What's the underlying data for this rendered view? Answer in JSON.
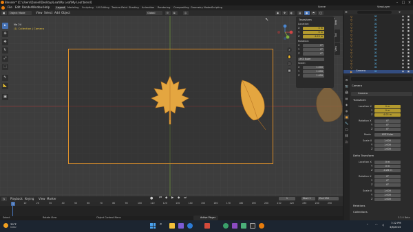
{
  "app": {
    "title": "Blender* [C:\\Users\\Daniel\\Desktop\\Leaf\\My Leaf\\My Leaf.blend]"
  },
  "menus": [
    "File",
    "Edit",
    "Render",
    "Window",
    "Help"
  ],
  "workspace_tabs": [
    {
      "label": "Layout",
      "active": true
    },
    {
      "label": "Modeling",
      "active": false
    },
    {
      "label": "Sculpting",
      "active": false
    },
    {
      "label": "UV Editing",
      "active": false
    },
    {
      "label": "Texture Paint",
      "active": false
    },
    {
      "label": "Shading",
      "active": false
    },
    {
      "label": "Animation",
      "active": false
    },
    {
      "label": "Rendering",
      "active": false
    },
    {
      "label": "Compositing",
      "active": false
    },
    {
      "label": "Geometry Nodes",
      "active": false
    },
    {
      "label": "Scripting",
      "active": false
    }
  ],
  "scene_label": "Scene",
  "viewlayer_label": "ViewLayer",
  "viewport_header": {
    "mode": "Object Mode",
    "menus": [
      "View",
      "Select",
      "Add",
      "Object"
    ],
    "transform_orientation": "Global",
    "options_label": "Options"
  },
  "viewport": {
    "camera_name": "No 24",
    "collection_path": "(1) Collection | Camera"
  },
  "npanel": {
    "title": "Transform",
    "location_label": "Location:",
    "location": [
      {
        "axis": "X",
        "value": "0 m"
      },
      {
        "axis": "Y",
        "value": "0 m"
      },
      {
        "axis": "Z",
        "value": "4.03 m"
      }
    ],
    "rotation_label": "Rotation:",
    "rotation": [
      {
        "axis": "X",
        "value": "0°"
      },
      {
        "axis": "Y",
        "value": "0°"
      },
      {
        "axis": "Z",
        "value": "0°"
      }
    ],
    "rotation_mode": "XYZ Euler",
    "scale_label": "Scale:",
    "scale": [
      {
        "axis": "X",
        "value": "1.000"
      },
      {
        "axis": "Y",
        "value": "1.000"
      },
      {
        "axis": "Z",
        "value": "1.000"
      }
    ],
    "tabs": [
      "Item",
      "Tool",
      "View"
    ]
  },
  "outliner": {
    "rows": [
      {
        "name": "",
        "selected": false
      },
      {
        "name": "",
        "selected": false
      },
      {
        "name": "",
        "selected": false
      },
      {
        "name": "",
        "selected": false
      },
      {
        "name": "",
        "selected": false
      },
      {
        "name": "",
        "selected": false
      },
      {
        "name": "",
        "selected": false
      },
      {
        "name": "",
        "selected": false
      },
      {
        "name": "",
        "selected": false
      },
      {
        "name": "",
        "selected": false
      },
      {
        "name": "",
        "selected": false
      },
      {
        "name": "",
        "selected": false
      },
      {
        "name": "",
        "selected": false
      },
      {
        "name": "",
        "selected": false
      },
      {
        "name": "",
        "selected": false
      },
      {
        "name": "Camera",
        "selected": true
      }
    ]
  },
  "properties": {
    "object_name": "Camera",
    "object_field": "Camera",
    "transform_label": "Transform",
    "location_label": "Location X",
    "location": [
      {
        "axis": "X",
        "value": "0 m"
      },
      {
        "axis": "Y",
        "value": "0 m"
      },
      {
        "axis": "Z",
        "value": "4.03 m"
      }
    ],
    "rotation_label": "Rotation X",
    "rotation": [
      {
        "axis": "X",
        "value": "0°"
      },
      {
        "axis": "Y",
        "value": "0°"
      },
      {
        "axis": "Z",
        "value": "0°"
      }
    ],
    "mode_label": "Mode",
    "mode_value": "XYZ Euler",
    "scale_label": "Scale X",
    "scale": [
      {
        "axis": "X",
        "value": "1.000"
      },
      {
        "axis": "Y",
        "value": "1.000"
      },
      {
        "axis": "Z",
        "value": "1.000"
      }
    ],
    "delta_label": "Delta Transform",
    "delta_location_label": "Location X",
    "delta_location": [
      {
        "axis": "X",
        "value": "0 m"
      },
      {
        "axis": "Y",
        "value": "0 m"
      },
      {
        "axis": "Z",
        "value": "-0.28 m"
      }
    ],
    "delta_rotation_label": "Rotation X",
    "delta_rotation": [
      {
        "axis": "X",
        "value": "0°"
      },
      {
        "axis": "Y",
        "value": "0°"
      },
      {
        "axis": "Z",
        "value": "0°"
      }
    ],
    "delta_scale_label": "Scale X",
    "delta_scale": [
      {
        "axis": "X",
        "value": "1.000"
      },
      {
        "axis": "Y",
        "value": "1.000"
      },
      {
        "axis": "Z",
        "value": "1.000"
      }
    ],
    "relations_label": "Relations",
    "collections_label": "Collections"
  },
  "timeline": {
    "menus": [
      "Playback",
      "Keying",
      "View",
      "Marker"
    ],
    "current_frame": "1",
    "start_label": "Start",
    "start": "1",
    "end_label": "End",
    "end": "250",
    "ruler": [
      "1",
      "10",
      "20",
      "30",
      "40",
      "50",
      "60",
      "70",
      "80",
      "90",
      "100",
      "110",
      "120",
      "130",
      "140",
      "150",
      "160",
      "170",
      "180",
      "190",
      "200",
      "210",
      "220",
      "230",
      "240",
      "250"
    ]
  },
  "statusbar": {
    "select": "Select",
    "rotate_view": "Rotate View",
    "context_menu": "Object Context Menu",
    "version": "3.3.0 Beta"
  },
  "taskbar": {
    "weather_temp": "39°F",
    "weather_desc": "Clear",
    "time": "7:22 PM",
    "date": "3/6/2023",
    "popup": "Active Player"
  },
  "colors": {
    "accent": "#4772b3",
    "selection": "#e8a23c",
    "gold_field": "#b39a2e",
    "leaf": "#e4a640"
  }
}
